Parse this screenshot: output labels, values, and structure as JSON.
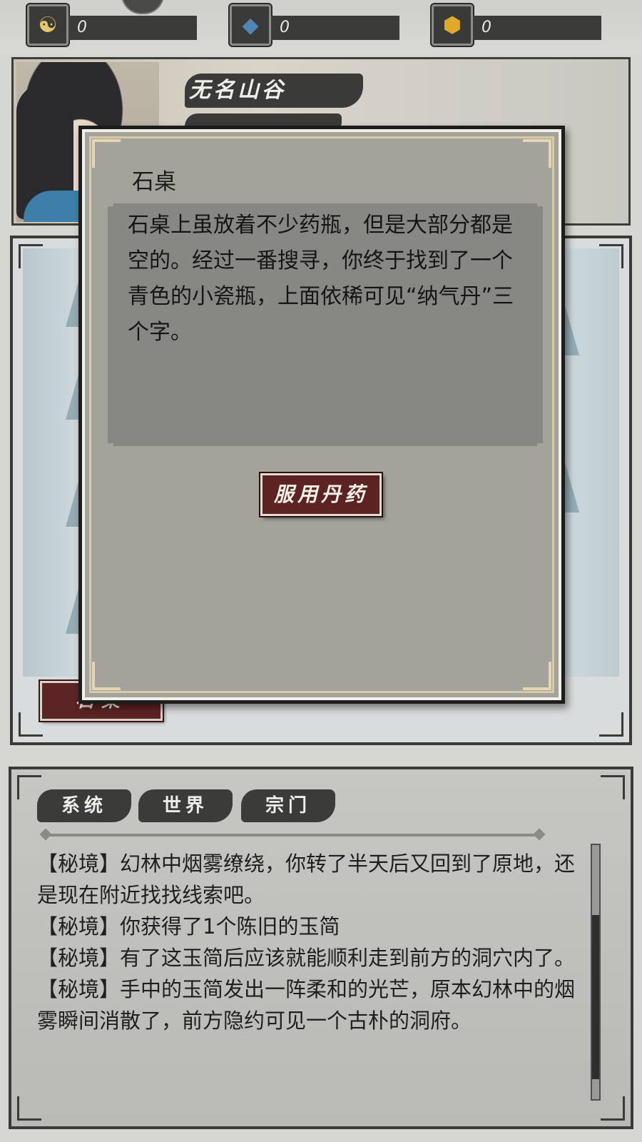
{
  "resources": [
    {
      "icon": "taiji-icon",
      "glyph": "☯",
      "value": "0"
    },
    {
      "icon": "crystal-icon",
      "glyph": "◆",
      "value": "0"
    },
    {
      "icon": "gold-gem-icon",
      "glyph": "⬢",
      "value": "0"
    }
  ],
  "location": {
    "title": "无名山谷"
  },
  "scene": {
    "hotspot_label": "石桌"
  },
  "dialog": {
    "title": "石桌",
    "body": "石桌上虽放着不少药瓶，但是大部分都是空的。经过一番搜寻，你终于找到了一个青色的小瓷瓶，上面依稀可见“纳气丹”三个字。",
    "action_label": "服用丹药"
  },
  "log": {
    "tabs": [
      "系统",
      "世界",
      "宗门"
    ],
    "entries": [
      "【秘境】幻林中烟雾缭绕，你转了半天后又回到了原地，还是现在附近找找线索吧。",
      "【秘境】你获得了1个陈旧的玉简",
      "【秘境】有了这玉简后应该就能顺利走到前方的洞穴内了。",
      "【秘境】手中的玉简发出一阵柔和的光芒，原本幻林中的烟雾瞬间消散了，前方隐约可见一个古朴的洞府。"
    ]
  },
  "colors": {
    "accent_red": "#5d2222",
    "panel_gray": "#a4a39b",
    "ink": "#3a3a38"
  }
}
